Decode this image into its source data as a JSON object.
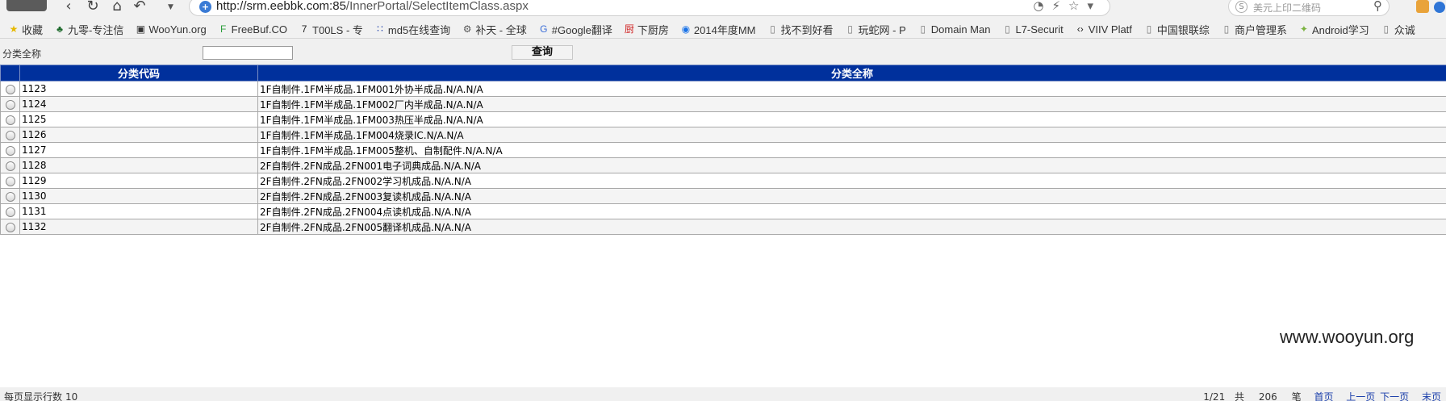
{
  "browser": {
    "url_host": "http://srm.eebbk.com:85",
    "url_path": "/InnerPortal/SelectItemClass.aspx",
    "search_placeholder": "美元上印二维码",
    "bookmarks": [
      {
        "icon": "star-icon",
        "label": "收藏"
      },
      {
        "icon": "tree-icon",
        "label": "九零-专注信"
      },
      {
        "icon": "wooyun-icon",
        "label": "WooYun.org"
      },
      {
        "icon": "freebuf-icon",
        "label": "FreeBuf.CO"
      },
      {
        "icon": "tools-icon",
        "label": "T00LS - 专"
      },
      {
        "icon": "grid-icon",
        "label": "md5在线查询"
      },
      {
        "icon": "gear-icon",
        "label": "补天 - 全球"
      },
      {
        "icon": "translate-icon",
        "label": "#Google翻译"
      },
      {
        "icon": "kitchen-icon",
        "label": "下厨房"
      },
      {
        "icon": "circle-icon",
        "label": "2014年度MM"
      },
      {
        "icon": "page-icon",
        "label": "找不到好看"
      },
      {
        "icon": "page-icon",
        "label": "玩蛇网 - P"
      },
      {
        "icon": "page-icon",
        "label": "Domain Man"
      },
      {
        "icon": "page-icon",
        "label": "L7-Securit"
      },
      {
        "icon": "code-icon",
        "label": "VIIV Platf"
      },
      {
        "icon": "page-icon",
        "label": "中国银联综"
      },
      {
        "icon": "page-icon",
        "label": "商户管理系"
      },
      {
        "icon": "android-icon",
        "label": "Android学习"
      },
      {
        "icon": "page-icon",
        "label": "众诚"
      }
    ]
  },
  "search": {
    "label": "分类全称",
    "value": "",
    "button": "查询"
  },
  "table": {
    "headers": [
      "分类代码",
      "分类全称"
    ],
    "rows": [
      {
        "code": "1123",
        "name": "1F自制件.1FM半成品.1FM001外协半成品.N/A.N/A"
      },
      {
        "code": "1124",
        "name": "1F自制件.1FM半成品.1FM002厂内半成品.N/A.N/A"
      },
      {
        "code": "1125",
        "name": "1F自制件.1FM半成品.1FM003热压半成品.N/A.N/A"
      },
      {
        "code": "1126",
        "name": "1F自制件.1FM半成品.1FM004烧录IC.N/A.N/A"
      },
      {
        "code": "1127",
        "name": "1F自制件.1FM半成品.1FM005整机、自制配件.N/A.N/A"
      },
      {
        "code": "1128",
        "name": "2F自制件.2FN成品.2FN001电子词典成品.N/A.N/A"
      },
      {
        "code": "1129",
        "name": "2F自制件.2FN成品.2FN002学习机成品.N/A.N/A"
      },
      {
        "code": "1130",
        "name": "2F自制件.2FN成品.2FN003复读机成品.N/A.N/A"
      },
      {
        "code": "1131",
        "name": "2F自制件.2FN成品.2FN004点读机成品.N/A.N/A"
      },
      {
        "code": "1132",
        "name": "2F自制件.2FN成品.2FN005翻译机成品.N/A.N/A"
      }
    ]
  },
  "footer": {
    "rows_label": "每页显示行数",
    "rows_value": "10",
    "page_info": "1/21",
    "total_prefix": "共",
    "total_count": "206",
    "total_suffix": "笔",
    "first": "首页",
    "prev": "上一页",
    "next": "下一页",
    "last": "末页"
  },
  "watermark": "www.wooyun.org",
  "colors": {
    "header_bg": "#00309c",
    "link": "#1a3eaa"
  }
}
